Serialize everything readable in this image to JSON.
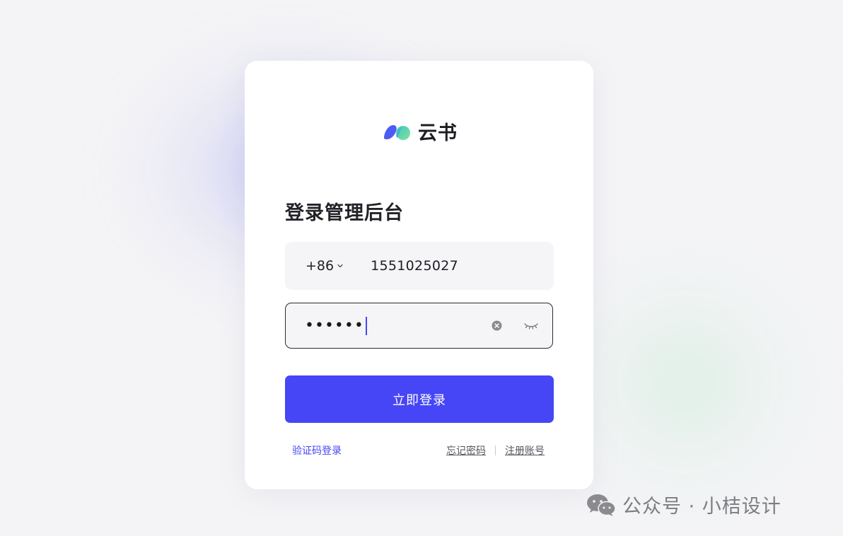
{
  "brand": {
    "name": "云书",
    "colors": {
      "primary": "#4646f6",
      "logo_blue": "#4d5bf5",
      "logo_green": "#5fd3a2"
    }
  },
  "login": {
    "title": "登录管理后台",
    "phone": {
      "country_code": "+86",
      "value": "1551025027"
    },
    "password": {
      "masked_value": "••••••"
    },
    "submit_label": "立即登录",
    "sms_login_label": "验证码登录",
    "forgot_password_label": "忘记密码",
    "register_label": "注册账号"
  },
  "watermark": {
    "text": "公众号 · 小桔设计"
  },
  "icons": {
    "logo": "cloud-logo-icon",
    "country_dropdown": "chevron-down-icon",
    "clear": "clear-icon",
    "toggle_visibility": "eye-closed-icon",
    "watermark": "wechat-icon"
  }
}
